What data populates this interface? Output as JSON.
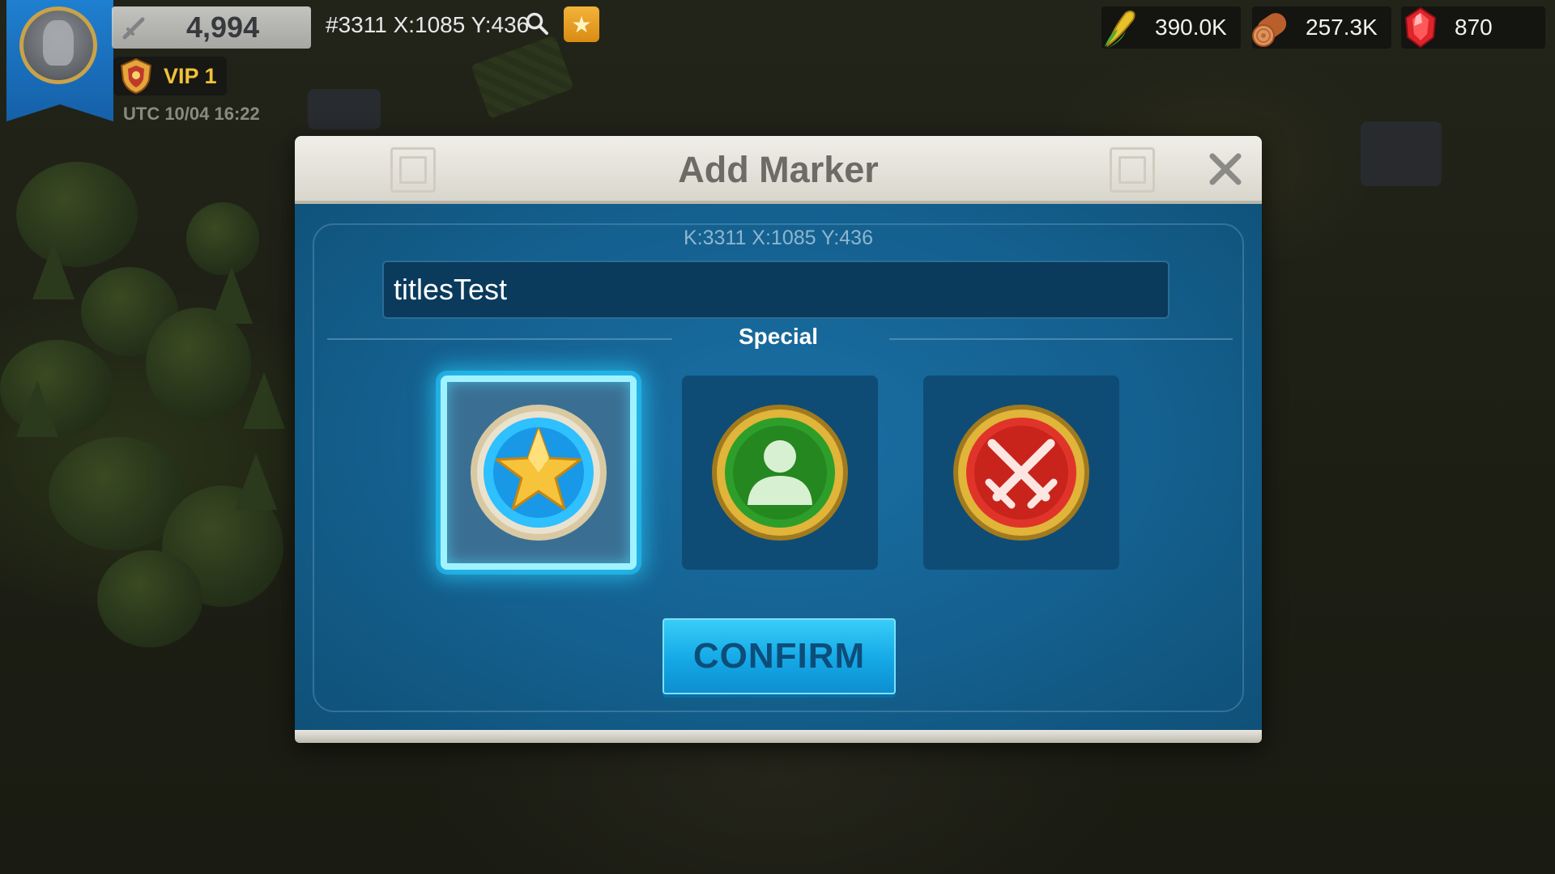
{
  "hud": {
    "power": "4,994",
    "coordinates": "#3311 X:1085 Y:436",
    "vip": "VIP 1",
    "utc_time": "UTC 10/04 16:22"
  },
  "resources": {
    "food": "390.0K",
    "wood": "257.3K",
    "gems": "870"
  },
  "dialog": {
    "title": "Add Marker",
    "coordinates": "K:3311 X:1085 Y:436",
    "marker_name": "titlesTest",
    "section_title": "Special",
    "markers": [
      {
        "type": "star-icon",
        "selected": true
      },
      {
        "type": "person-icon",
        "selected": false
      },
      {
        "type": "crossed-swords-icon",
        "selected": false
      }
    ],
    "confirm_label": "CONFIRM"
  },
  "colors": {
    "dialog_blue": "#14608f",
    "confirm_blue": "#14a8e6",
    "selection_glow": "#9ff3ff",
    "vip_gold": "#f0c23a"
  }
}
